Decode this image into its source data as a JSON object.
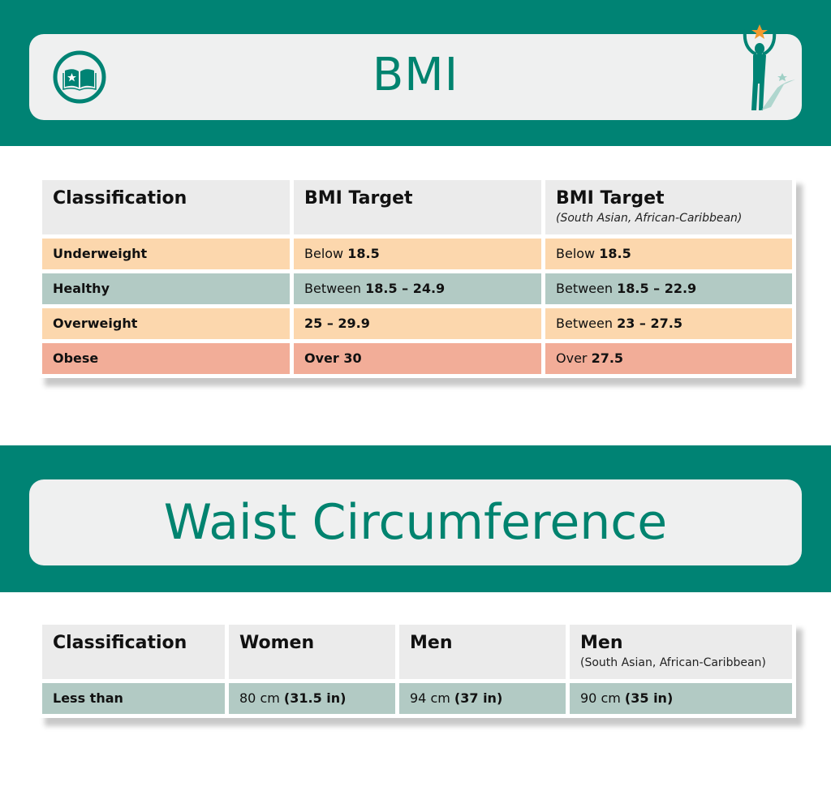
{
  "colors": {
    "brand_teal": "#008374",
    "title_teal": "#00836f",
    "card_bg": "#eff0f0",
    "header_bg": "#ebebeb",
    "underweight": "#fcd7ad",
    "healthy": "#b2cac4",
    "overweight": "#fcd7ad",
    "obese": "#f2ad98",
    "star_orange": "#f39a2e"
  },
  "bmi_section": {
    "title": "BMI",
    "icons": {
      "left": "open-book-star-icon",
      "right": "person-reaching-star-icon"
    },
    "table": {
      "headers": [
        {
          "title": "Classification",
          "subtitle": ""
        },
        {
          "title": "BMI Target",
          "subtitle": ""
        },
        {
          "title": "BMI Target",
          "subtitle": "(South Asian, African-Caribbean)"
        }
      ],
      "rows": [
        {
          "classification": "Underweight",
          "standard": {
            "prefix": "Below ",
            "value": "18.5"
          },
          "ethnic": {
            "prefix": "Below ",
            "value": "18.5"
          }
        },
        {
          "classification": "Healthy",
          "standard": {
            "prefix": "Between ",
            "value": "18.5 – 24.9"
          },
          "ethnic": {
            "prefix": "Between ",
            "value": "18.5 – 22.9"
          }
        },
        {
          "classification": "Overweight",
          "standard": {
            "prefix": "",
            "value": "25 – 29.9"
          },
          "ethnic": {
            "prefix": "Between ",
            "value": "23 – 27.5"
          }
        },
        {
          "classification": "Obese",
          "standard": {
            "prefix": "",
            "value": "Over 30"
          },
          "ethnic": {
            "prefix": "Over ",
            "value": "27.5"
          }
        }
      ]
    }
  },
  "waist_section": {
    "title": "Waist Circumference",
    "table": {
      "headers": [
        {
          "title": "Classification",
          "subtitle": ""
        },
        {
          "title": "Women",
          "subtitle": ""
        },
        {
          "title": "Men",
          "subtitle": ""
        },
        {
          "title": "Men",
          "subtitle": "(South Asian, African-Caribbean)"
        }
      ],
      "rows": [
        {
          "classification": "Less than",
          "women": {
            "prefix": "80 cm ",
            "value": "(31.5 in)"
          },
          "men": {
            "prefix": "94 cm ",
            "value": "(37 in)"
          },
          "men_ethnic": {
            "prefix": "90 cm ",
            "value": "(35 in)"
          }
        }
      ]
    }
  }
}
